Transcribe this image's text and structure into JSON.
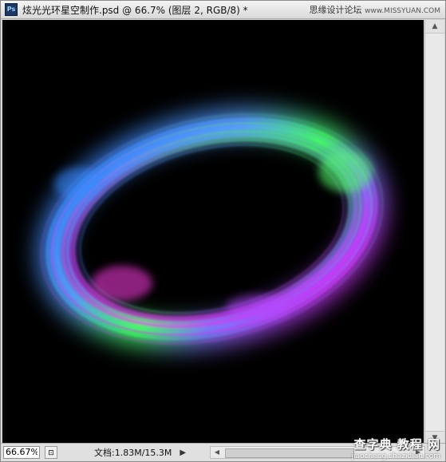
{
  "window": {
    "title": "炫光光环星空制作.psd @ 66.7% (图层 2, RGB/8) *",
    "app_icon": "Ps"
  },
  "watermark_top": {
    "main": "思缘设计论坛",
    "site": "www.MISSYUAN.COM"
  },
  "controls": {
    "minimize": "—",
    "maximize": "□",
    "close": "✕"
  },
  "status": {
    "zoom": "66.67%",
    "doc_info": "文档:1.83M/15.3M",
    "arrow": "▶"
  },
  "watermark_bottom": {
    "main": "查字典 教程 网",
    "url": "jiaocheng.chazidian.com"
  },
  "colors": {
    "canvas_bg": "#000000",
    "ring_blue": "#3b8fff",
    "ring_green": "#4dff6b",
    "ring_magenta": "#ff39e0",
    "ring_purple": "#9b5cff"
  }
}
